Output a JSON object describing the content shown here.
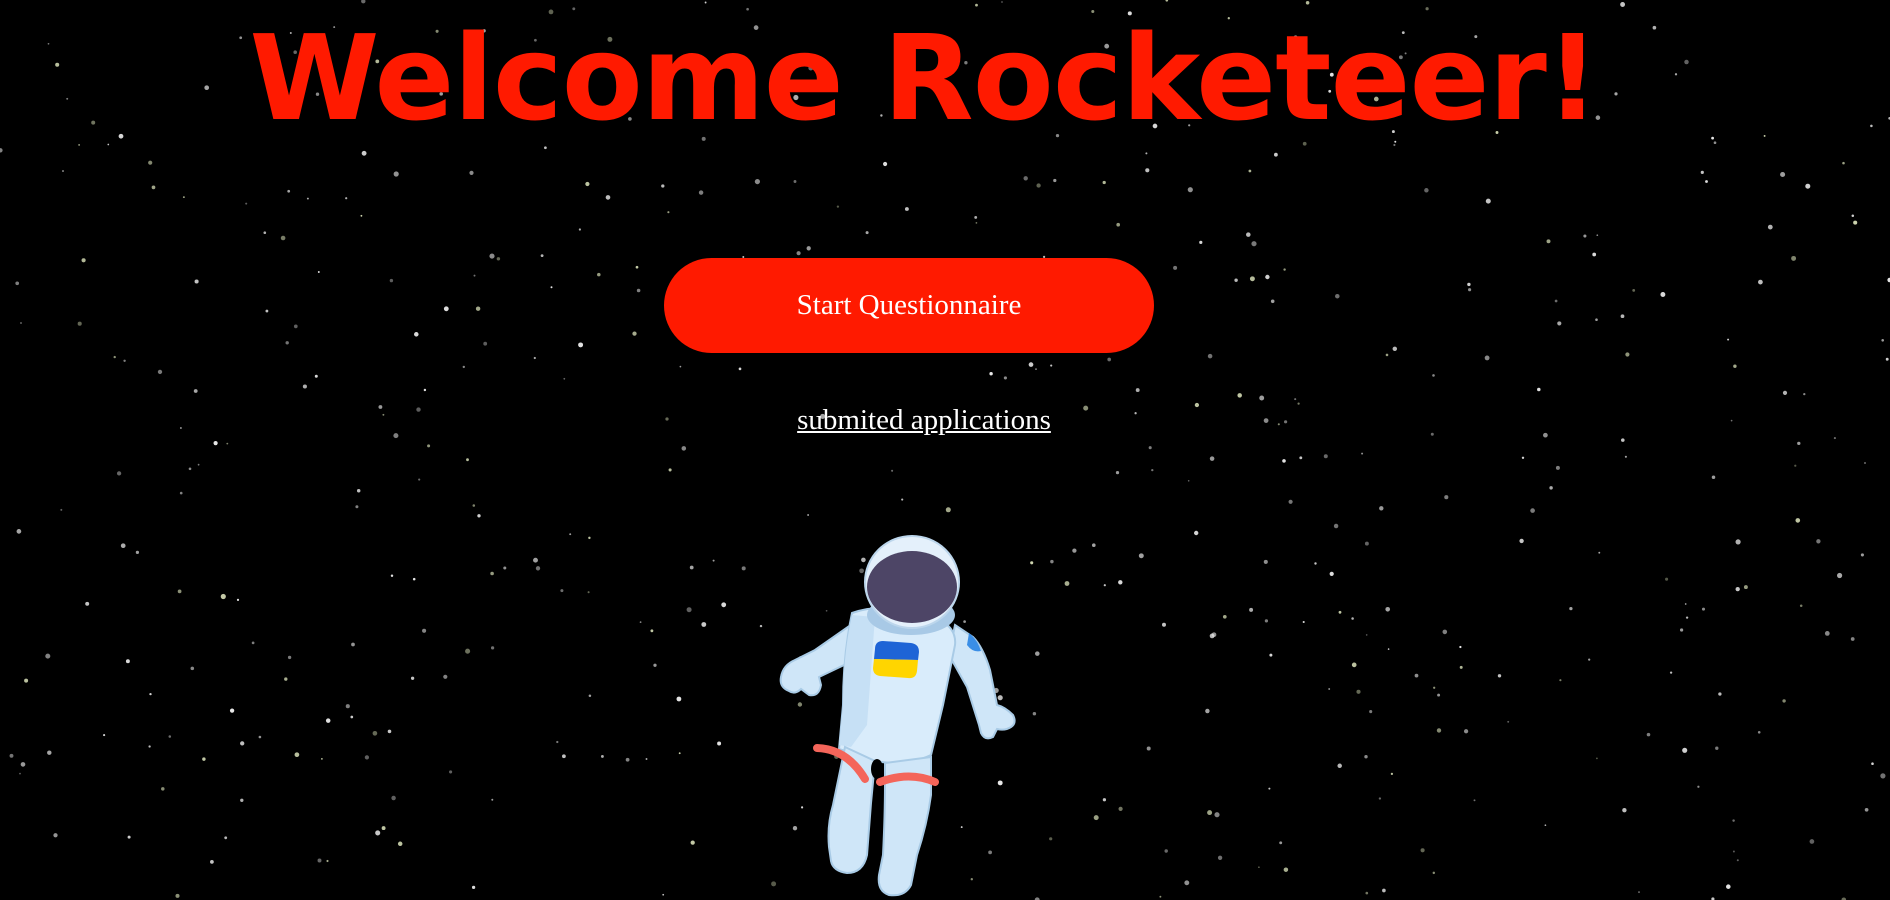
{
  "page": {
    "title": "Welcome Rocketeer!",
    "start_button_label": "Start Questionnaire",
    "applications_link_label": "submited applications"
  },
  "colors": {
    "background": "#000000",
    "accent": "#ff1a00",
    "text": "#ffffff"
  },
  "icons": {
    "astronaut": "astronaut-illustration",
    "flag": "ukraine-flag-patch"
  }
}
